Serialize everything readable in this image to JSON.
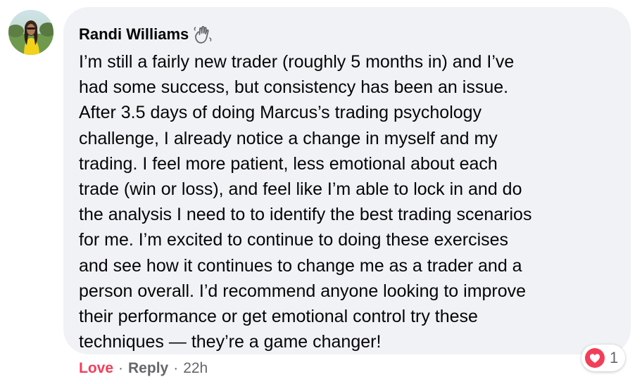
{
  "comment": {
    "author": "Randi Williams",
    "author_badge_icon": "wave-hand-icon",
    "text": "I’m still a fairly new trader (roughly 5 months in) and I’ve\nhad some success, but consistency has been an issue.\nAfter 3.5 days of doing Marcus’s trading psychology\nchallenge, I already notice a change in myself and my\ntrading. I feel more patient, less emotional about each\ntrade (win or loss), and feel like I’m able to lock in and do\nthe analysis I need to to identify the best trading scenarios\nfor me. I’m excited to continue to doing these exercises\nand see how it continues to change me as a trader and a\nperson overall. I’d recommend anyone looking to improve\ntheir performance or get emotional control try these\ntechniques — they’re a game changer!"
  },
  "actions": {
    "love_label": "Love",
    "separator": "·",
    "reply_label": "Reply",
    "timestamp": "22h"
  },
  "reactions": {
    "icon": "heart-reaction-icon",
    "count": "1"
  },
  "colors": {
    "bubble_bg": "#f0f2f5",
    "love_red": "#f33e58",
    "secondary_text": "#65676b",
    "primary_text": "#050505"
  }
}
